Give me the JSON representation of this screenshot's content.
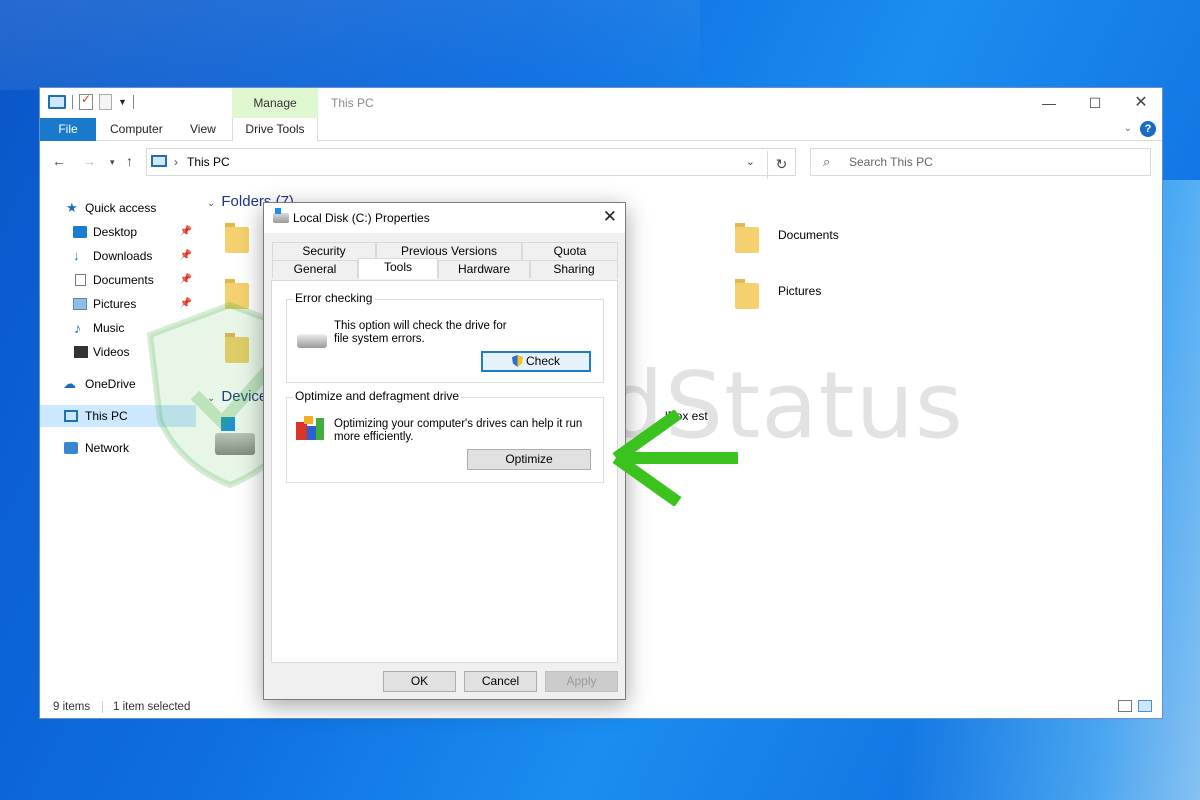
{
  "window": {
    "title": "This PC",
    "context_tab": "Manage",
    "controls": {
      "minimize": "—",
      "maximize": "☐",
      "close": "✕"
    }
  },
  "ribbon": {
    "tabs": [
      "File",
      "Computer",
      "View",
      "Drive Tools"
    ],
    "expand": "⌄",
    "help": "?"
  },
  "address": {
    "location": "This PC",
    "search_placeholder": "Search This PC"
  },
  "nav_pane": {
    "items": [
      {
        "label": "Quick access",
        "icon": "star-icon"
      },
      {
        "label": "Desktop",
        "icon": "desktop-icon",
        "pinned": true
      },
      {
        "label": "Downloads",
        "icon": "download-icon",
        "pinned": true
      },
      {
        "label": "Documents",
        "icon": "document-icon",
        "pinned": true
      },
      {
        "label": "Pictures",
        "icon": "pictures-icon",
        "pinned": true
      },
      {
        "label": "Music",
        "icon": "music-icon"
      },
      {
        "label": "Videos",
        "icon": "videos-icon"
      },
      {
        "label": "OneDrive",
        "icon": "cloud-icon"
      },
      {
        "label": "This PC",
        "icon": "computer-icon",
        "selected": true
      },
      {
        "label": "Network",
        "icon": "network-icon"
      }
    ]
  },
  "content": {
    "folders_header": "Folders (7)",
    "devices_header": "Device",
    "folders_right": [
      "Documents",
      "Pictures"
    ],
    "partial_label": "lBox est"
  },
  "status": {
    "items": "9 items",
    "selected": "1 item selected"
  },
  "dialog": {
    "title": "Local Disk (C:) Properties",
    "tabs_back": [
      "Security",
      "Previous Versions",
      "Quota"
    ],
    "tabs_front": [
      "General",
      "Tools",
      "Hardware",
      "Sharing"
    ],
    "selected_tab": "Tools",
    "error_checking": {
      "title": "Error checking",
      "text": "This option will check the drive for file system errors.",
      "button": "Check"
    },
    "optimize": {
      "title": "Optimize and defragment drive",
      "text": "Optimizing your computer's drives can help it run more efficiently.",
      "button": "Optimize"
    },
    "buttons": {
      "ok": "OK",
      "cancel": "Cancel",
      "apply": "Apply"
    }
  },
  "watermark": {
    "text": "SecuredStatus"
  },
  "colors": {
    "accent": "#1979ca",
    "arrow": "#3cc21f",
    "context_tab": "#dff7d0"
  }
}
